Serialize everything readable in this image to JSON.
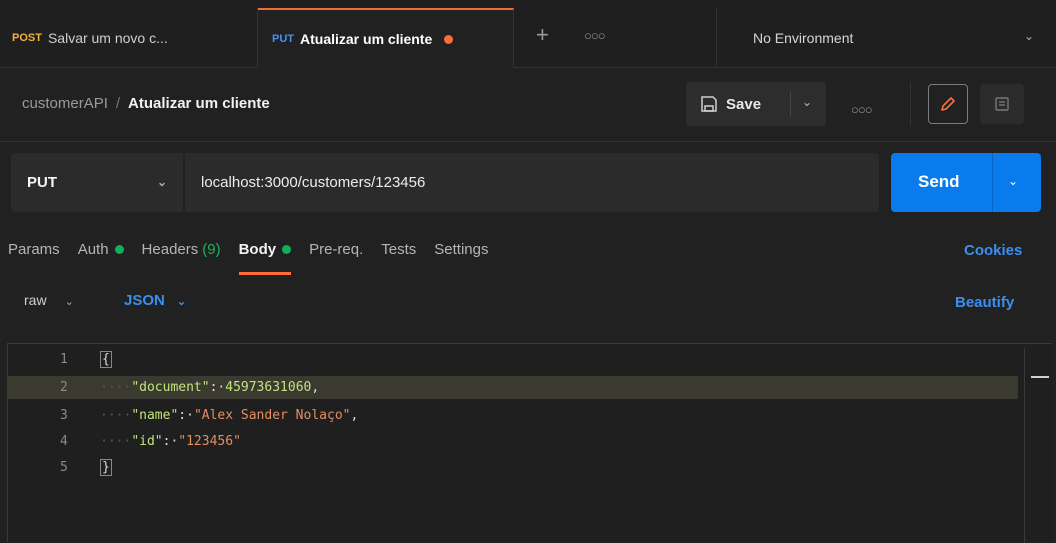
{
  "tabs": [
    {
      "method": "POST",
      "title": "Salvar um novo c...",
      "method_color": "#f2b23c"
    },
    {
      "method": "PUT",
      "title": "Atualizar um cliente",
      "method_color": "#4a8ef0",
      "unsaved": true
    }
  ],
  "environment": {
    "label": "No Environment"
  },
  "breadcrumb": {
    "collection": "customerAPI",
    "separator": "/",
    "request": "Atualizar um cliente"
  },
  "toolbar": {
    "save_label": "Save"
  },
  "request": {
    "method": "PUT",
    "url": "localhost:3000/customers/123456",
    "send_label": "Send"
  },
  "request_tabs": {
    "params": "Params",
    "auth": "Auth",
    "headers": "Headers",
    "headers_count": "(9)",
    "body": "Body",
    "prereq": "Pre-req.",
    "tests": "Tests",
    "settings": "Settings",
    "cookies": "Cookies"
  },
  "body_options": {
    "mode": "raw",
    "language": "JSON",
    "beautify": "Beautify"
  },
  "editor": {
    "line_numbers": [
      "1",
      "2",
      "3",
      "4",
      "5"
    ],
    "open_brace": "{",
    "close_brace": "}",
    "lines": [
      {
        "key": "\"document\"",
        "value": "45973631060"
      },
      {
        "key": "\"name\"",
        "value": "\"Alex Sander Nolaço\""
      },
      {
        "key": "\"id\"",
        "value": "\"123456\""
      }
    ]
  },
  "colors": {
    "accent_orange": "#ff6c37",
    "send_blue": "#097bed",
    "link_blue": "#3b8ff0",
    "status_green": "#10b05a"
  }
}
